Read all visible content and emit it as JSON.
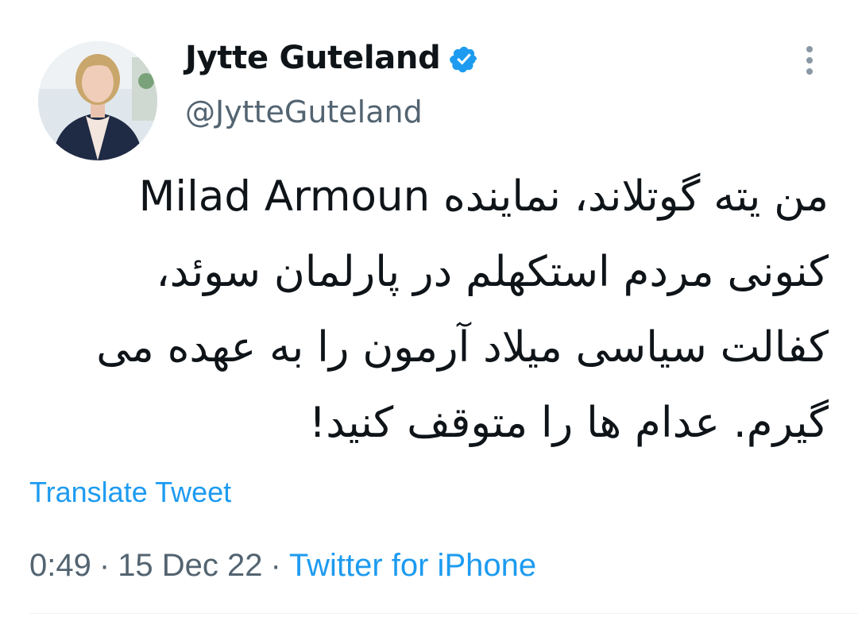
{
  "tweet": {
    "author": {
      "name": "Jytte Guteland",
      "handle": "@JytteGuteland",
      "verified": true
    },
    "text_lines": [
      "من یته گوتلاند، نماینده Milad Armoun",
      "کنونی مردم  استکهلم در پارلمان سوئد،",
      "کفالت سیاسی میلاد آرمون را به عهده می",
      "گیرم. عدام ها را متوقف کنید!"
    ],
    "translate_label": "Translate Tweet",
    "time": "0:49",
    "date": "15 Dec 22",
    "source": "Twitter for iPhone",
    "separator": "·"
  },
  "icons": {
    "verified": "verified-badge-icon",
    "more": "more-vertical-icon"
  },
  "colors": {
    "accent": "#1d9bf0",
    "text": "#0f1419",
    "muted": "#536471"
  }
}
